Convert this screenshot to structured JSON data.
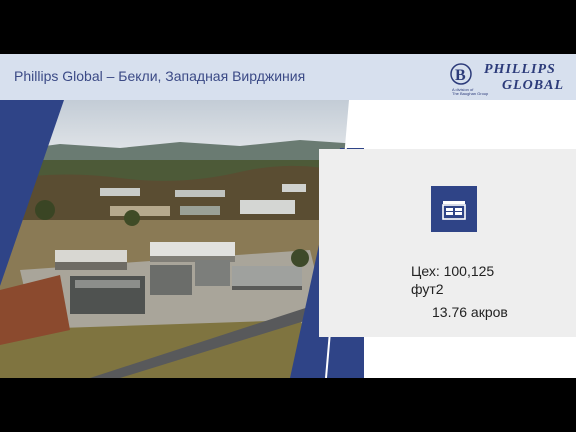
{
  "slide": {
    "title": "Phillips Global – Бекли, Западная Вирджиния",
    "logo": {
      "line1": "Phillips",
      "line2": "Global",
      "tag1": "A division of",
      "tag2": "The Baughan Group"
    },
    "icon": "warehouse-icon",
    "stats": {
      "shop_area_line1": "Цех: 100,125",
      "shop_area_line2": "фут2",
      "acreage": "13.76 акров"
    },
    "colors": {
      "header_bg": "#d7e0ee",
      "accent": "#2f4487",
      "title_text": "#3b4a86",
      "panel_bg": "#eeeeee"
    }
  }
}
